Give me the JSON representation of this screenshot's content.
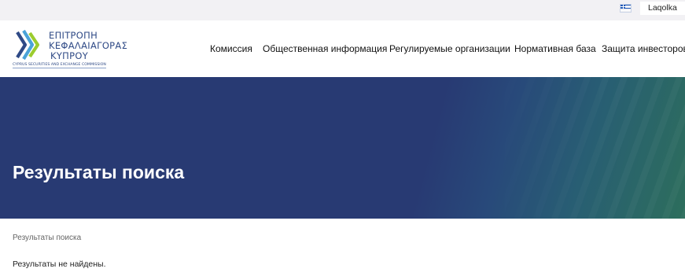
{
  "topbar": {
    "flag_icon": "greek-flag-icon",
    "language_label": "Laqolka"
  },
  "logo": {
    "line1": "ΕΠΙΤΡΟΠΗ",
    "line2": "ΚΕΦΑΛΑΙΑΓΟΡΑΣ",
    "line3": "ΚΥΠΡΟΥ",
    "subtitle": "CYPRUS SECURITIES AND EXCHANGE COMMISSION",
    "colors": {
      "green": "#9ccc2e",
      "blue": "#2f4a86",
      "lightblue": "#4aa3d8"
    }
  },
  "nav": {
    "items": [
      {
        "label": "Комиссия"
      },
      {
        "label": "Общественная информация"
      },
      {
        "label": "Регулируемые организации"
      },
      {
        "label": "Нормативная база"
      },
      {
        "label": "Защита инвесторов"
      }
    ]
  },
  "banner": {
    "title": "Результаты поиска",
    "colors": {
      "base": "#283a73",
      "accent": "#2d6e5c"
    }
  },
  "breadcrumb": {
    "current": "Результаты поиска"
  },
  "results": {
    "message": "Результаты не найдены."
  }
}
